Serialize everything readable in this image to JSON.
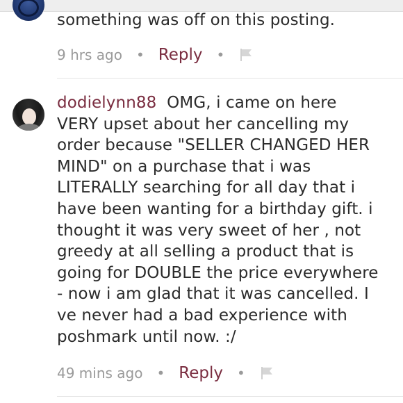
{
  "comments": [
    {
      "text_fragment": "something was off on this posting.",
      "time": "9 hrs ago",
      "reply_label": "Reply",
      "avatar_icon": "user-avatar-icon"
    },
    {
      "username": "dodielynn88",
      "lines": [
        "OMG, i came on here",
        "VERY upset about her cancelling my",
        "order because \"SELLER CHANGED HER",
        "MIND\" on a purchase that i was",
        "LITERALLY searching for all day that i",
        "have been wanting for a birthday gift. i",
        "thought it was very sweet of her , not",
        "greedy at all selling a product that is",
        "going for DOUBLE the price everywhere",
        "- now i am glad that it was cancelled. I",
        "ve never had a bad experience with",
        "poshmark until now. :/"
      ],
      "time": "49 mins ago",
      "reply_label": "Reply",
      "avatar_icon": "user-avatar-icon"
    }
  ],
  "meta": {
    "separator": "•",
    "flag_icon": "flag-icon"
  },
  "colors": {
    "username": "#7a2d40",
    "reply": "#7a2d40",
    "timestamp": "#9a9a9a",
    "text": "#2b2b2b"
  }
}
